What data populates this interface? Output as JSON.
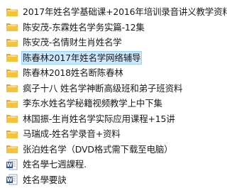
{
  "items": [
    {
      "label": "2017年姓名学基础课+2016年培训录音讲义教学资料",
      "type": "folder",
      "selected": false
    },
    {
      "label": "陈安茂-东霖姓名学务实篇-12集",
      "type": "folder",
      "selected": false
    },
    {
      "label": "陈安茂-名情财生肖姓名学",
      "type": "folder",
      "selected": false
    },
    {
      "label": "陈春林2017年姓名学网络辅导",
      "type": "folder",
      "selected": true
    },
    {
      "label": "陈春林2018姓名断陈春林",
      "type": "folder",
      "selected": false
    },
    {
      "label": "疯子十八 姓名学神断高级班和弟子班资料",
      "type": "folder",
      "selected": false
    },
    {
      "label": "李东水姓名学秘籍视频教学上中下集",
      "type": "folder",
      "selected": false
    },
    {
      "label": "林国振-生肖姓名学实际应用课程+15讲",
      "type": "folder",
      "selected": false
    },
    {
      "label": "马瑞成-姓名学录音+资料",
      "type": "folder",
      "selected": false
    },
    {
      "label": "张泊姓名学（DVD格式需下载至电脑）",
      "type": "folder",
      "selected": false
    },
    {
      "label": "姓名學七週課程.",
      "type": "word-doc",
      "selected": false
    },
    {
      "label": "姓名學要訣",
      "type": "word-doc",
      "selected": false
    }
  ],
  "colors": {
    "folder_body": "#f5c33b",
    "folder_back": "#e0a82a",
    "folder_paper": "#ffffff",
    "word_blue": "#2b579a",
    "selection": "#cce8ff"
  }
}
